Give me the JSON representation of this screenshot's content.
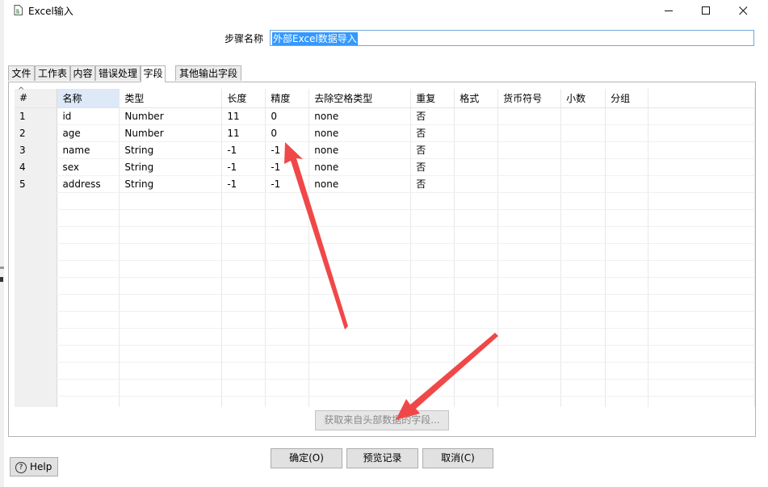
{
  "window": {
    "title": "Excel输入",
    "app_icon": "pdi-file-icon",
    "controls": {
      "minimize": "—",
      "maximize": "☐",
      "close": "✕"
    }
  },
  "step": {
    "label": "步骤名称",
    "value": "外部Excel数据导入"
  },
  "tabs": [
    {
      "label": "文件",
      "active": false
    },
    {
      "label": "工作表",
      "active": false
    },
    {
      "label": "内容",
      "active": false
    },
    {
      "label": "错误处理",
      "active": false
    },
    {
      "label": "字段",
      "active": true
    },
    {
      "label": "其他输出字段",
      "active": false
    }
  ],
  "table": {
    "sort_indicator": "^",
    "headers": [
      "#",
      "名称",
      "类型",
      "长度",
      "精度",
      "去除空格类型",
      "重复",
      "格式",
      "货币符号",
      "小数",
      "分组"
    ],
    "rows": [
      [
        "1",
        "id",
        "Number",
        "11",
        "0",
        "none",
        "否",
        "",
        "",
        "",
        ""
      ],
      [
        "2",
        "age",
        "Number",
        "11",
        "0",
        "none",
        "否",
        "",
        "",
        "",
        ""
      ],
      [
        "3",
        "name",
        "String",
        "-1",
        "-1",
        "none",
        "否",
        "",
        "",
        "",
        ""
      ],
      [
        "4",
        "sex",
        "String",
        "-1",
        "-1",
        "none",
        "否",
        "",
        "",
        "",
        ""
      ],
      [
        "5",
        "address",
        "String",
        "-1",
        "-1",
        "none",
        "否",
        "",
        "",
        "",
        ""
      ]
    ]
  },
  "buttons": {
    "get_fields": "获取来自头部数据的字段...",
    "ok": "确定(O)",
    "preview": "预览记录",
    "cancel": "取消(C)",
    "help": "Help",
    "help_icon": "?"
  },
  "colors": {
    "annotation_arrow": "#f04848",
    "selection": "#3399ff",
    "name_header": "#dde9f7"
  }
}
